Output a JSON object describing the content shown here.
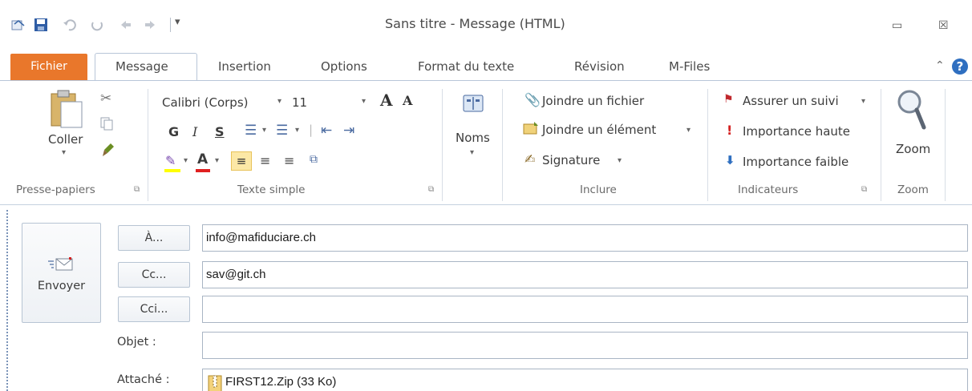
{
  "window": {
    "title": "Sans titre - Message (HTML)",
    "minimize_glyph": "▭",
    "close_glyph": "☒"
  },
  "tabs": {
    "file": "Fichier",
    "message": "Message",
    "insert": "Insertion",
    "options": "Options",
    "format": "Format du texte",
    "review": "Révision",
    "mfiles": "M-Files"
  },
  "ribbon": {
    "clipboard": {
      "paste": "Coller",
      "label": "Presse-papiers"
    },
    "basic_text": {
      "font": "Calibri (Corps)",
      "size": "11",
      "bold": "G",
      "italic": "I",
      "underline": "S",
      "label": "Texte simple"
    },
    "names": {
      "label": "Noms"
    },
    "include": {
      "attach_file": "Joindre un fichier",
      "attach_item": "Joindre un élément",
      "signature": "Signature",
      "label": "Inclure"
    },
    "tags": {
      "follow_up": "Assurer un suivi",
      "high": "Importance haute",
      "low": "Importance faible",
      "label": "Indicateurs"
    },
    "zoom": {
      "button": "Zoom",
      "label": "Zoom"
    }
  },
  "compose": {
    "send": "Envoyer",
    "to_button": "À...",
    "cc_button": "Cc...",
    "bcc_button": "Cci...",
    "to_value": "info@mafiduciare.ch",
    "cc_value": "sav@git.ch",
    "bcc_value": "",
    "subject_label": "Objet :",
    "subject_value": "",
    "attached_label": "Attaché :",
    "attachment": "FIRST12.Zip (33 Ko)"
  },
  "colors": {
    "file_tab": "#e9772b",
    "help_blue": "#2f6fc0"
  }
}
